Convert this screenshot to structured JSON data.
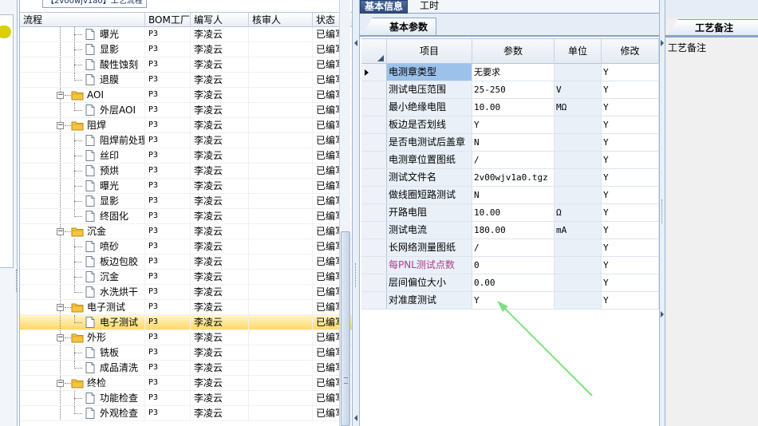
{
  "tree": {
    "title_tab": "【2v00wjv1a0】工艺流程",
    "headers": {
      "flow": "流程",
      "bom": "BOM工厂",
      "author": "编写人",
      "reviewer": "核审人",
      "status": "状态"
    },
    "rows": [
      {
        "label": "曝光",
        "level": 2,
        "bom": "P3",
        "author": "李凌云",
        "reviewer": "",
        "status": "已编写"
      },
      {
        "label": "显影",
        "level": 2,
        "bom": "P3",
        "author": "李凌云",
        "reviewer": "",
        "status": "已编写"
      },
      {
        "label": "酸性蚀刻",
        "level": 2,
        "bom": "P3",
        "author": "李凌云",
        "reviewer": "",
        "status": "已编写"
      },
      {
        "label": "退膜",
        "level": 2,
        "bom": "P3",
        "author": "李凌云",
        "reviewer": "",
        "status": "已编写"
      },
      {
        "label": "AOI",
        "level": 1,
        "bom": "P3",
        "author": "李凌云",
        "reviewer": "",
        "status": "已编写"
      },
      {
        "label": "外层AOI",
        "level": 2,
        "bom": "P3",
        "author": "李凌云",
        "reviewer": "",
        "status": "已编写"
      },
      {
        "label": "阻焊",
        "level": 1,
        "bom": "P3",
        "author": "李凌云",
        "reviewer": "",
        "status": "已编写"
      },
      {
        "label": "阻焊前处理",
        "level": 2,
        "bom": "P3",
        "author": "李凌云",
        "reviewer": "",
        "status": "已编写"
      },
      {
        "label": "丝印",
        "level": 2,
        "bom": "P3",
        "author": "李凌云",
        "reviewer": "",
        "status": "已编写"
      },
      {
        "label": "预烘",
        "level": 2,
        "bom": "P3",
        "author": "李凌云",
        "reviewer": "",
        "status": "已编写"
      },
      {
        "label": "曝光",
        "level": 2,
        "bom": "P3",
        "author": "李凌云",
        "reviewer": "",
        "status": "已编写"
      },
      {
        "label": "显影",
        "level": 2,
        "bom": "P3",
        "author": "李凌云",
        "reviewer": "",
        "status": "已编写"
      },
      {
        "label": "终固化",
        "level": 2,
        "bom": "P3",
        "author": "李凌云",
        "reviewer": "",
        "status": "已编写"
      },
      {
        "label": "沉金",
        "level": 1,
        "bom": "P3",
        "author": "李凌云",
        "reviewer": "",
        "status": "已编写"
      },
      {
        "label": "喷砂",
        "level": 2,
        "bom": "P3",
        "author": "李凌云",
        "reviewer": "",
        "status": "已编写"
      },
      {
        "label": "板边包胶",
        "level": 2,
        "bom": "P3",
        "author": "李凌云",
        "reviewer": "",
        "status": "已编写"
      },
      {
        "label": "沉金",
        "level": 2,
        "bom": "P3",
        "author": "李凌云",
        "reviewer": "",
        "status": "已编写"
      },
      {
        "label": "水洗烘干",
        "level": 2,
        "bom": "P3",
        "author": "李凌云",
        "reviewer": "",
        "status": "已编写"
      },
      {
        "label": "电子测试",
        "level": 1,
        "bom": "P3",
        "author": "李凌云",
        "reviewer": "",
        "status": "已编写"
      },
      {
        "label": "电子测试",
        "level": 2,
        "bom": "P3",
        "author": "李凌云",
        "reviewer": "",
        "status": "已编写",
        "selected": true
      },
      {
        "label": "外形",
        "level": 1,
        "bom": "P3",
        "author": "李凌云",
        "reviewer": "",
        "status": "已编写"
      },
      {
        "label": "铣板",
        "level": 2,
        "bom": "P3",
        "author": "李凌云",
        "reviewer": "",
        "status": "已编写"
      },
      {
        "label": "成品清洗",
        "level": 2,
        "bom": "P3",
        "author": "李凌云",
        "reviewer": "",
        "status": "已编写"
      },
      {
        "label": "终检",
        "level": 1,
        "bom": "P3",
        "author": "李凌云",
        "reviewer": "",
        "status": "已编写"
      },
      {
        "label": "功能检查",
        "level": 2,
        "bom": "P3",
        "author": "李凌云",
        "reviewer": "",
        "status": "已编写"
      },
      {
        "label": "外观检查",
        "level": 2,
        "bom": "P3",
        "author": "李凌云",
        "reviewer": "",
        "status": "已编写"
      }
    ]
  },
  "main": {
    "tabs": [
      {
        "label": "基本信息",
        "active": true
      },
      {
        "label": "工时",
        "active": false
      }
    ],
    "sub_tab": "基本参数",
    "grid": {
      "headers": {
        "item": "项目",
        "param": "参数",
        "unit": "单位",
        "modify": "修改"
      },
      "rows": [
        {
          "item": "电测章类型",
          "param": "无要求",
          "unit": "",
          "modify": "Y",
          "current": true
        },
        {
          "item": "测试电压范围",
          "param": "25-250",
          "unit": "V",
          "modify": "Y"
        },
        {
          "item": "最小绝缘电阻",
          "param": "10.00",
          "unit": "MΩ",
          "modify": "Y"
        },
        {
          "item": "板边是否划线",
          "param": "Y",
          "unit": "",
          "modify": "Y"
        },
        {
          "item": "是否电测试后盖章",
          "param": "N",
          "unit": "",
          "modify": "Y"
        },
        {
          "item": "电测章位置图纸",
          "param": "/",
          "unit": "",
          "modify": "Y"
        },
        {
          "item": "测试文件名",
          "param": "2v00wjv1a0.tgz",
          "unit": "",
          "modify": "Y"
        },
        {
          "item": "做线圈短路测试",
          "param": "N",
          "unit": "",
          "modify": "Y"
        },
        {
          "item": "开路电阻",
          "param": "10.00",
          "unit": "Ω",
          "modify": "Y"
        },
        {
          "item": "测试电流",
          "param": "180.00",
          "unit": "mA",
          "modify": "Y"
        },
        {
          "item": "长网络测量图纸",
          "param": "/",
          "unit": "",
          "modify": "Y"
        },
        {
          "item": "每PNL测试点数",
          "param": "0",
          "unit": "",
          "modify": "Y",
          "highlight": true
        },
        {
          "item": "层间偏位大小",
          "param": "0.00",
          "unit": "",
          "modify": "Y"
        },
        {
          "item": "对准度测试",
          "param": "Y",
          "unit": "",
          "modify": "Y"
        }
      ]
    }
  },
  "right": {
    "tab": "工艺备注",
    "label": "工艺备注"
  },
  "colors": {
    "selection": "#ffd86a",
    "current_cell": "#9cc2ec",
    "highlight_text": "#b03a8c",
    "annotation_arrow": "#7ee07e"
  }
}
